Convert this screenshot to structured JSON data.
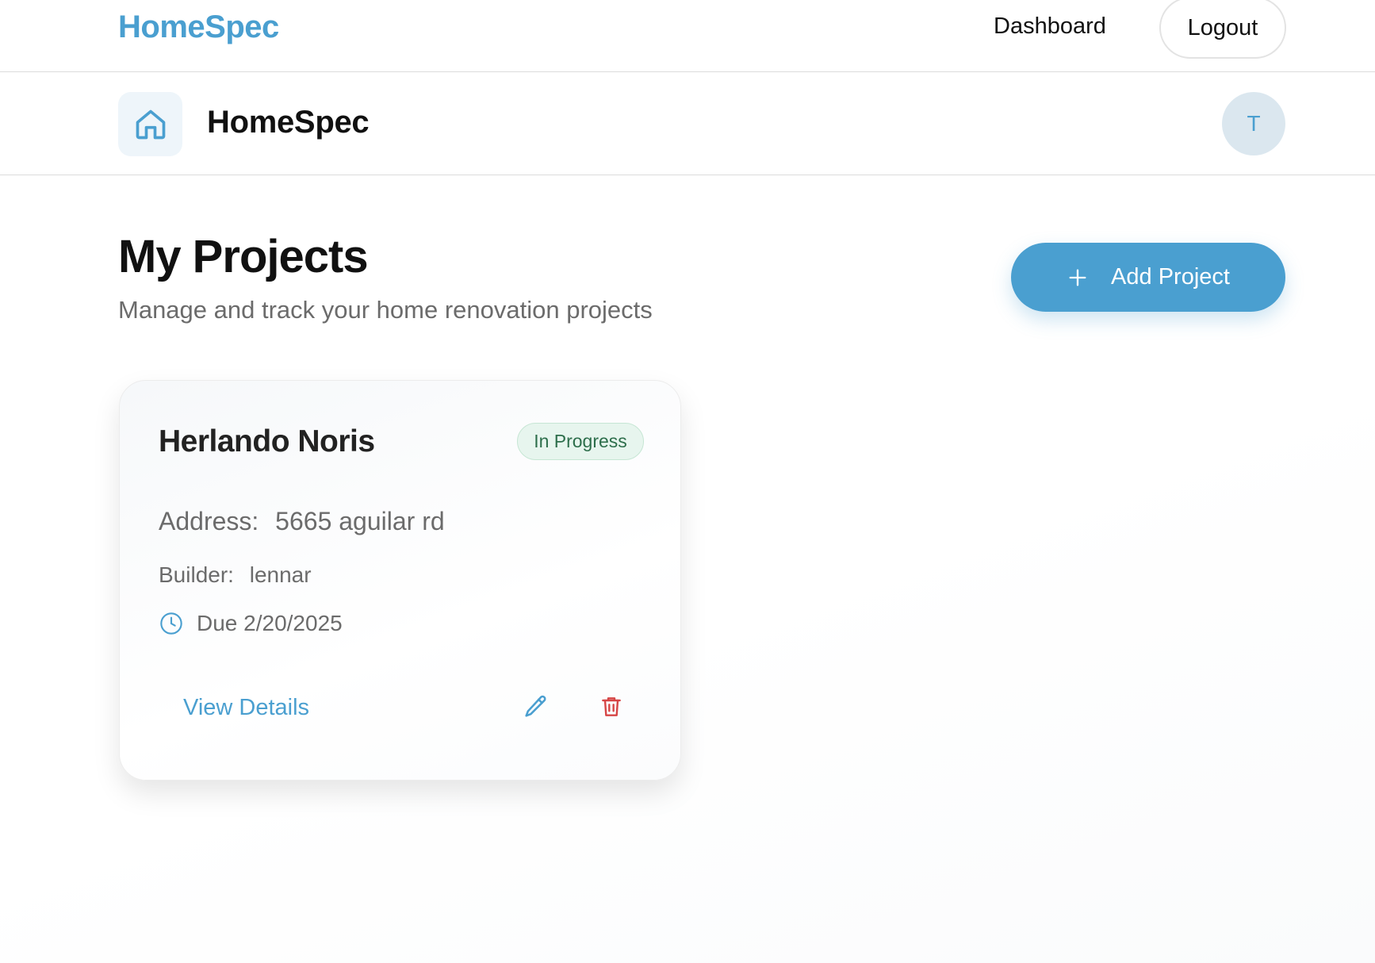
{
  "topnav": {
    "brand": "HomeSpec",
    "links": [
      {
        "label": "Dashboard"
      }
    ],
    "logout_label": "Logout"
  },
  "subheader": {
    "home_icon": "home-icon",
    "title": "HomeSpec",
    "avatar_initial": "T"
  },
  "main": {
    "title": "My Projects",
    "subtitle": "Manage and track your home renovation projects",
    "add_button_label": "Add Project",
    "add_icon": "plus-icon"
  },
  "projects": [
    {
      "name": "Herlando Noris",
      "status": "In Progress",
      "address_label": "Address:",
      "address": "5665 aguilar rd",
      "builder_label": "Builder:",
      "builder": "lennar",
      "due": "Due 2/20/2025",
      "due_icon": "clock-icon",
      "view_label": "View Details",
      "edit_icon": "pencil-icon",
      "delete_icon": "trash-icon"
    }
  ],
  "colors": {
    "accent": "#4a9fd0",
    "status_bg": "#e7f5ee",
    "status_text": "#2d6e4b",
    "danger": "#d64545",
    "muted_text": "#6b6b6b"
  }
}
